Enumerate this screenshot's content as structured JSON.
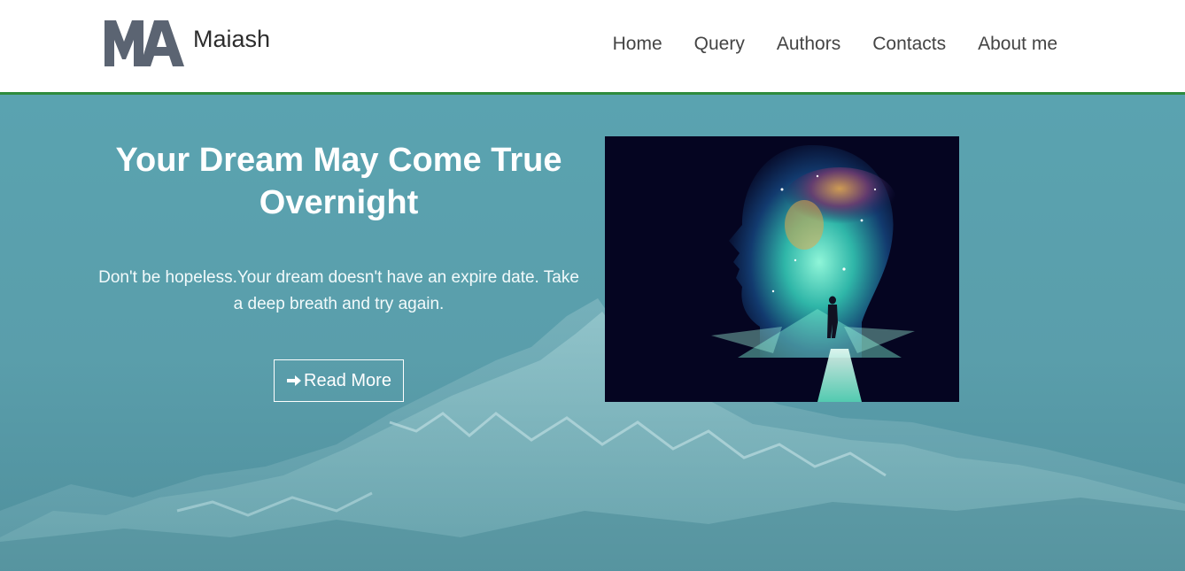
{
  "brand": {
    "logo_text": "MA",
    "name": "Maiash"
  },
  "nav": {
    "items": [
      "Home",
      "Query",
      "Authors",
      "Contacts",
      "About me"
    ]
  },
  "hero": {
    "title": "Your Dream May Come True Overnight",
    "description": "Don't be hopeless.Your dream doesn't have an expire date. Take a deep breath and try again.",
    "button_label": "Read More",
    "button_icon": "arrow-right-icon",
    "image_icon": "cosmic-head-image"
  },
  "colors": {
    "header_bg": "#ffffff",
    "header_border": "#2e8b3d",
    "hero_bg": "#5a9eab",
    "logo": "#5b6472",
    "text_light": "#ffffff"
  }
}
